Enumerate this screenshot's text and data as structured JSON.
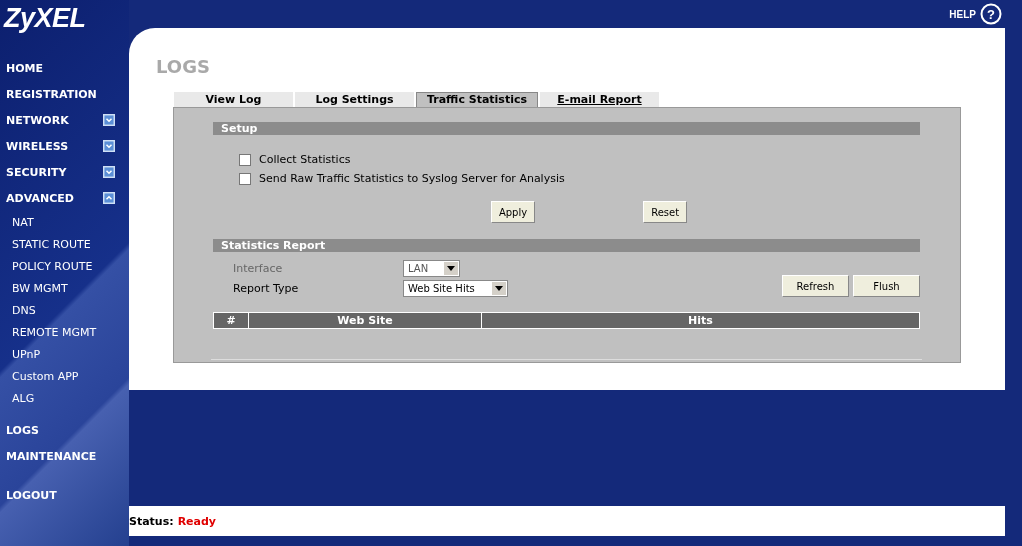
{
  "logo": "ZyXEL",
  "help": {
    "label": "HELP",
    "icon": "?"
  },
  "sidebar": {
    "items": [
      {
        "label": "HOME",
        "kind": "plain"
      },
      {
        "label": "REGISTRATION",
        "kind": "plain"
      },
      {
        "label": "NETWORK",
        "kind": "group",
        "expanded": false
      },
      {
        "label": "WIRELESS",
        "kind": "group",
        "expanded": false
      },
      {
        "label": "SECURITY",
        "kind": "group",
        "expanded": false
      },
      {
        "label": "ADVANCED",
        "kind": "group",
        "expanded": true,
        "children": [
          {
            "label": "NAT"
          },
          {
            "label": "STATIC ROUTE"
          },
          {
            "label": "POLICY ROUTE"
          },
          {
            "label": "BW MGMT"
          },
          {
            "label": "DNS"
          },
          {
            "label": "REMOTE MGMT"
          },
          {
            "label": "UPnP"
          },
          {
            "label": "Custom APP"
          },
          {
            "label": "ALG"
          }
        ]
      },
      {
        "label": "LOGS",
        "kind": "plain"
      },
      {
        "label": "MAINTENANCE",
        "kind": "plain"
      }
    ],
    "logout": "LOGOUT"
  },
  "page": {
    "title": "LOGS",
    "tabs": [
      {
        "label": "View Log",
        "selected": false,
        "underlined": false
      },
      {
        "label": "Log Settings",
        "selected": false,
        "underlined": false
      },
      {
        "label": "Traffic Statistics",
        "selected": true,
        "underlined": false
      },
      {
        "label": "E-mail Report",
        "selected": false,
        "underlined": true
      }
    ],
    "setup": {
      "title": "Setup",
      "checkboxes": [
        {
          "label": "Collect Statistics",
          "checked": false
        },
        {
          "label": "Send Raw Traffic Statistics to Syslog Server for Analysis",
          "checked": false
        }
      ],
      "buttons": [
        "Apply",
        "Reset"
      ]
    },
    "report": {
      "title": "Statistics Report",
      "fields": [
        {
          "label": "Interface",
          "value": "LAN",
          "disabled": true
        },
        {
          "label": "Report Type",
          "value": "Web Site Hits",
          "disabled": false
        }
      ],
      "buttons": [
        "Refresh",
        "Flush"
      ],
      "table": {
        "columns": [
          "#",
          "Web Site",
          "Hits"
        ]
      }
    }
  },
  "status": {
    "label": "Status:",
    "value": "Ready"
  }
}
